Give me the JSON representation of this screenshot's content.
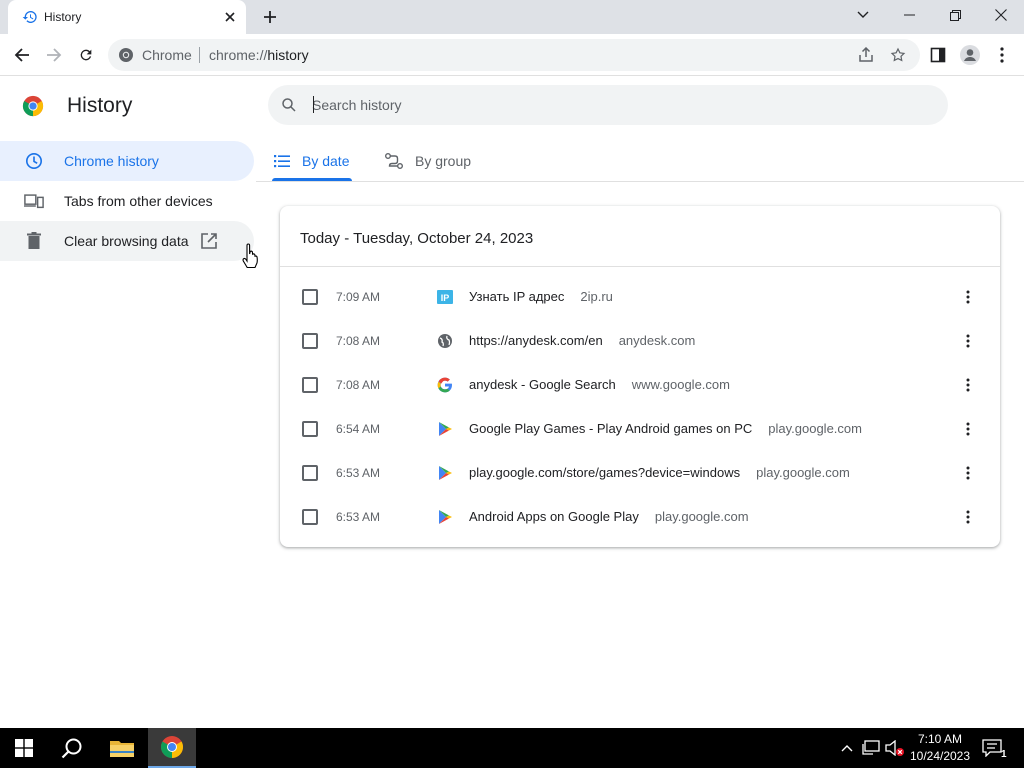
{
  "browser": {
    "tab_title": "History",
    "omnibox": {
      "chip": "Chrome",
      "url_scheme": "chrome://",
      "url_path": "history"
    }
  },
  "page": {
    "title": "History",
    "search_placeholder": "Search history",
    "sidebar": [
      {
        "label": "Chrome history",
        "icon": "clock-icon"
      },
      {
        "label": "Tabs from other devices",
        "icon": "devices-icon"
      },
      {
        "label": "Clear browsing data",
        "icon": "trash-icon"
      }
    ],
    "tabs": [
      {
        "label": "By date",
        "icon": "list-icon"
      },
      {
        "label": "By group",
        "icon": "group-icon"
      }
    ],
    "day_header": "Today - Tuesday, October 24, 2023",
    "entries": [
      {
        "time": "7:09 AM",
        "title": "Узнать IP адрес",
        "domain": "2ip.ru",
        "favicon": "ip-icon"
      },
      {
        "time": "7:08 AM",
        "title": "https://anydesk.com/en",
        "domain": "anydesk.com",
        "favicon": "globe-icon"
      },
      {
        "time": "7:08 AM",
        "title": "anydesk - Google Search",
        "domain": "www.google.com",
        "favicon": "google-icon"
      },
      {
        "time": "6:54 AM",
        "title": "Google Play Games - Play Android games on PC",
        "domain": "play.google.com",
        "favicon": "play-icon"
      },
      {
        "time": "6:53 AM",
        "title": "play.google.com/store/games?device=windows",
        "domain": "play.google.com",
        "favicon": "play-icon"
      },
      {
        "time": "6:53 AM",
        "title": "Android Apps on Google Play",
        "domain": "play.google.com",
        "favicon": "play-icon"
      }
    ]
  },
  "taskbar": {
    "time": "7:10 AM",
    "date": "10/24/2023",
    "notification_count": "1"
  },
  "colors": {
    "accent": "#1a73e8",
    "tab_strip": "#dee1e6",
    "active_nav_bg": "#e8f0fe"
  }
}
